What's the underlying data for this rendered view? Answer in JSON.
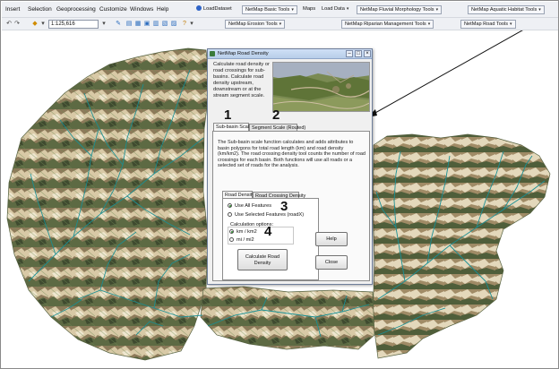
{
  "menu": {
    "items": [
      "Insert",
      "Selection",
      "Geoprocessing",
      "Customize",
      "Windows",
      "Help"
    ],
    "load_dataset": "LoadDataset",
    "basic_tools": "NetMap Basic Tools",
    "maps": "Maps",
    "load_data": "Load Data",
    "fluvial_tools": "NetMap Fluvial Morphology Tools",
    "aquatic_tools": "NetMap Aquatic Habitat Tools"
  },
  "toolbar": {
    "scale_value": "1:125,616",
    "erosion_tools": "NetMap Erosion Tools",
    "riparian_tools": "NetMap Riparian Management Tools",
    "road_tools": "NetMap Road Tools"
  },
  "dialog": {
    "title": "NetMap Road Density",
    "intro": "Calculate road density or road crossings for sub-basins. Calculate road density upstream, downstream or at the stream segment scale.",
    "tab_subbasin": "Sub-basin Scale",
    "tab_segment": "Segment Scale (Routed)",
    "description": "The Sub-basin scale function calculates and adds attributes to basin polygons for total road length (km) and road density (km/km2). The road crossing density tool counts the number of road crossings for each basin. Both functions will use all roads or a selected set of roads for the analysis.",
    "subtab_density": "Road Density",
    "subtab_crossing": "Road Crossing Density",
    "radio_all": "Use All Features",
    "radio_selected": "Use Selected Features (roadX)",
    "calc_label": "Calculation options:",
    "radio_km": "km / km2",
    "radio_mi": "mi / mi2",
    "calc_button": "Calculate Road Density",
    "help_button": "Help",
    "close_button": "Close"
  },
  "callouts": [
    "1",
    "2",
    "3",
    "4"
  ],
  "colors": {
    "relief_light": "#d8c9a6",
    "relief_mid": "#9a8460",
    "relief_dark": "#4a5a3a",
    "relief_green": "#6f8a54",
    "stream": "#1a8f94",
    "title_bar": "#c4d6ef"
  }
}
